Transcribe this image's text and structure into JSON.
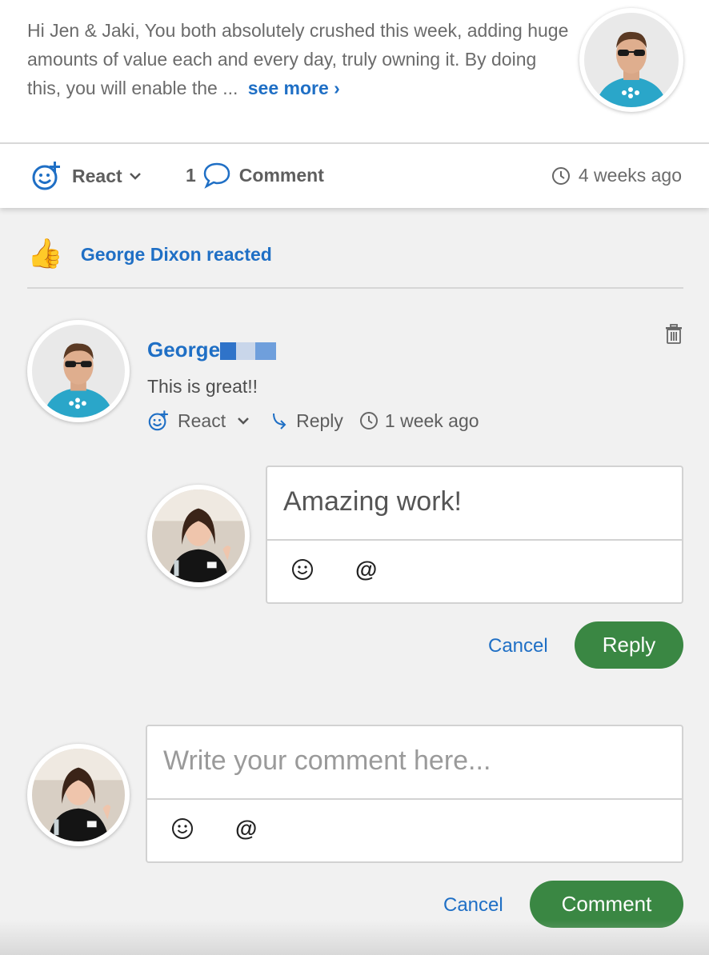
{
  "post": {
    "message": "Hi Jen & Jaki, You both absolutely crushed this week, adding huge amounts of value each and every day, truly owning it. By doing this, you will enable the ...",
    "see_more": "see more ›",
    "react_label": "React",
    "comment_count": "1",
    "comment_label": "Comment",
    "timestamp": "4 weeks ago"
  },
  "reactions": {
    "text": "George Dixon reacted",
    "icon": "thumbs-up-emoji",
    "emoji": "👍"
  },
  "comment": {
    "author": "George",
    "body": "This is great!!",
    "react_label": "React",
    "reply_label": "Reply",
    "timestamp": "1 week ago"
  },
  "reply_box": {
    "value": "Amazing work!",
    "emoji_tool": "☺",
    "mention_tool": "@",
    "cancel_label": "Cancel",
    "submit_label": "Reply"
  },
  "comment_box": {
    "placeholder": "Write your comment here...",
    "emoji_tool": "☺",
    "mention_tool": "@",
    "cancel_label": "Cancel",
    "submit_label": "Comment"
  },
  "colors": {
    "link_blue": "#1f6fc5",
    "button_green": "#3a8743",
    "redaction": [
      "#2f73c9",
      "#c9d6ea",
      "#6f9fdc"
    ]
  }
}
